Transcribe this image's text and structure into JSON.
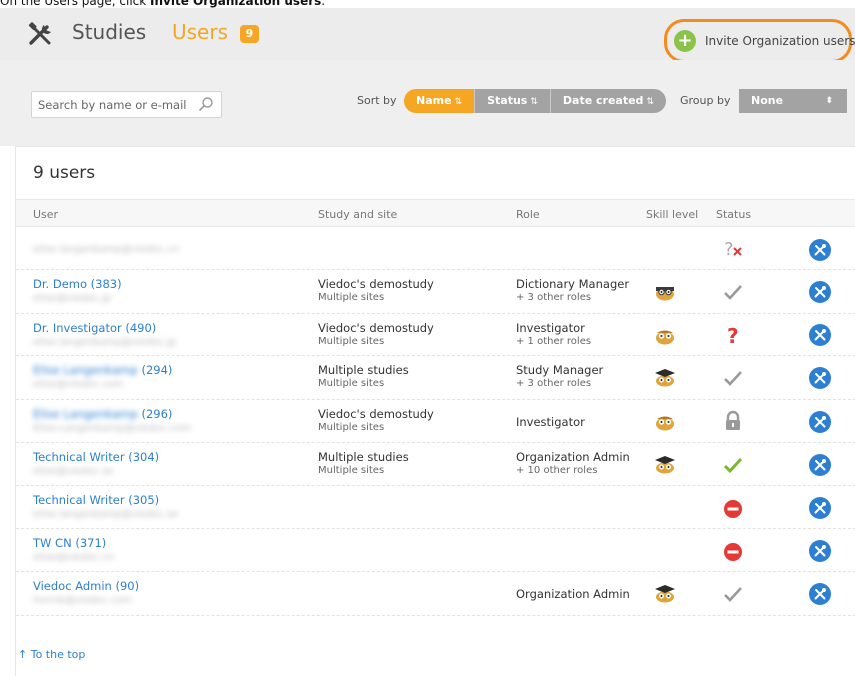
{
  "instruction": {
    "prefix": "On the Users page, click ",
    "target": "Invite Organization users",
    "suffix": "."
  },
  "header": {
    "nav_studies": "Studies",
    "nav_users": "Users",
    "users_count": "9",
    "invite_label": "Invite Organization users"
  },
  "filters": {
    "search_placeholder": "Search by name or e-mail",
    "sort_label": "Sort by",
    "sort_options": [
      "Name",
      "Status",
      "Date created"
    ],
    "sort_active": "Name",
    "group_label": "Group by",
    "group_value": "None"
  },
  "table": {
    "title": "9 users",
    "columns": [
      "User",
      "Study and site",
      "Role",
      "Skill level",
      "Status"
    ],
    "rows": [
      {
        "name": "",
        "email": "elise.langenkamp@viedoc.cn",
        "study": "",
        "sites": "",
        "role": "",
        "role_more": "",
        "skill": "",
        "status": "unknown-x"
      },
      {
        "name": "Dr. Demo (383)",
        "email": "elise@viedoc.jp",
        "study": "Viedoc's demostudy",
        "sites": "Multiple sites",
        "role": "Dictionary Manager",
        "role_more": "+ 3 other roles",
        "skill": "owl-glasses",
        "status": "check-gray"
      },
      {
        "name": "Dr. Investigator (490)",
        "email": "elise.langenkamp@viedoc.jp",
        "study": "Viedoc's demostudy",
        "sites": "Multiple sites",
        "role": "Investigator",
        "role_more": "+ 1 other roles",
        "skill": "owl",
        "status": "question-red"
      },
      {
        "name_blurred": "Elise Langenkamp",
        "name_suffix": " (294)",
        "email": "elise@viedoc.com",
        "study": "Multiple studies",
        "sites": "Multiple sites",
        "role": "Study Manager",
        "role_more": "+ 3 other roles",
        "skill": "owl-graduate",
        "status": "check-gray"
      },
      {
        "name_blurred": "Elise Langenkamp",
        "name_suffix": " (296)",
        "email": "Elise.Langenkamp@viedoc.com",
        "study": "Viedoc's demostudy",
        "sites": "Multiple sites",
        "role": "Investigator",
        "role_more": "",
        "skill": "owl",
        "status": "lock"
      },
      {
        "name": "Technical Writer (304)",
        "email": "elise@viedoc.se",
        "study": "Multiple studies",
        "sites": "Multiple sites",
        "role": "Organization Admin",
        "role_more": "+ 10 other roles",
        "skill": "owl-graduate",
        "status": "check-green"
      },
      {
        "name": "Technical Writer (305)",
        "email": "elise.langenkamp@viedoc.se",
        "study": "",
        "sites": "",
        "role": "",
        "role_more": "",
        "skill": "",
        "status": "blocked"
      },
      {
        "name": "TW CN (371)",
        "email": "elise@viedoc.cn",
        "study": "",
        "sites": "",
        "role": "",
        "role_more": "",
        "skill": "",
        "status": "blocked"
      },
      {
        "name": "Viedoc Admin (90)",
        "email": "henrik@viedoc.com",
        "study": "",
        "sites": "",
        "role": "Organization Admin",
        "role_more": "",
        "skill": "owl-graduate",
        "status": "check-gray"
      }
    ],
    "to_top": "To the top"
  },
  "colors": {
    "accent": "#f5a623",
    "link": "#2c7fd0",
    "invite_green": "#8bc34a",
    "highlight_ring": "#f28c1d",
    "action_blue": "#2d7fd3",
    "blocked_red": "#e53935"
  }
}
